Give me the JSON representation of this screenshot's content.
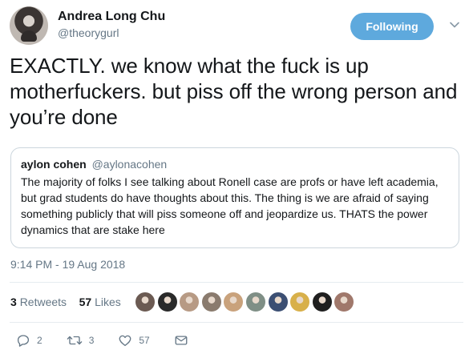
{
  "author": {
    "display_name": "Andrea Long Chu",
    "handle": "@theorygurl"
  },
  "follow_button_label": "Following",
  "tweet_text": "EXACTLY. we know what the fuck is up motherfuckers. but piss off the wrong person and you’re done",
  "quoted_tweet": {
    "display_name": "aylon cohen",
    "handle": "@aylonacohen",
    "text": "The majority of folks I see talking about Ronell case are profs or have left academia, but grad students do have thoughts about this. The thing is we are afraid of saying something publicly that will piss someone off and jeopardize us. THATS the power dynamics that are stake here"
  },
  "timestamp": "9:14 PM - 19 Aug 2018",
  "stats": {
    "retweets_count": "3",
    "retweets_label": "Retweets",
    "likes_count": "57",
    "likes_label": "Likes"
  },
  "likers_avatars": [
    {
      "color": "#6b5a52"
    },
    {
      "color": "#2a2a2a"
    },
    {
      "color": "#b79a84"
    },
    {
      "color": "#8a7b6e"
    },
    {
      "color": "#c9a27c"
    },
    {
      "color": "#7f8f86"
    },
    {
      "color": "#3c4f73"
    },
    {
      "color": "#d8b04a"
    },
    {
      "color": "#1f1f1f"
    },
    {
      "color": "#a0786b"
    }
  ],
  "actions": {
    "reply_count": "2",
    "retweet_count": "3",
    "like_count": "57"
  },
  "colors": {
    "accent": "#5ea9dd",
    "secondary_text": "#657786",
    "border": "#ccd6dd"
  }
}
